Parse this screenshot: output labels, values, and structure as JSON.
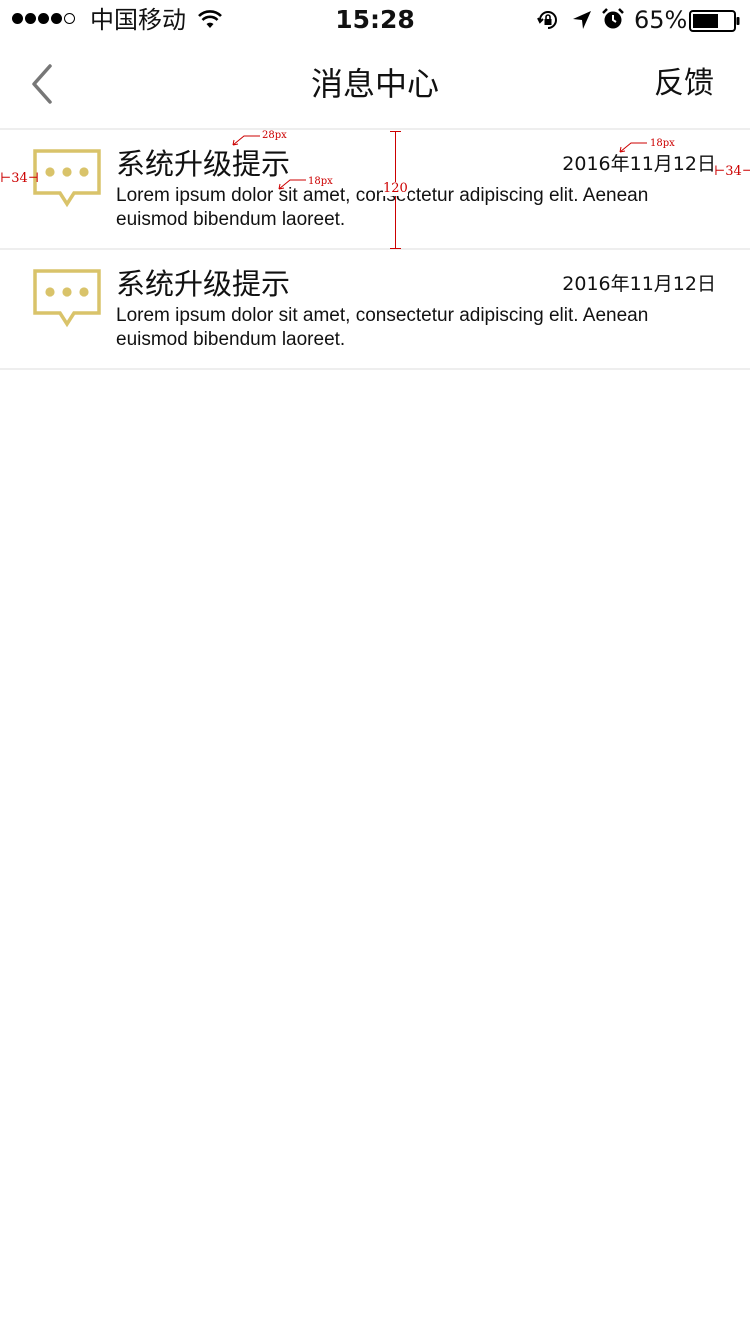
{
  "status_bar": {
    "carrier": "中国移动",
    "time": "15:28",
    "battery_percent": "65%",
    "battery_level": 0.65,
    "signal_bars_filled": 4,
    "signal_bars_total": 5,
    "icons": [
      "wifi-icon",
      "rotation-lock-icon",
      "location-icon",
      "alarm-icon",
      "battery-icon"
    ]
  },
  "nav": {
    "title": "消息中心",
    "right_button": "反馈",
    "back_icon": "chevron-left-icon"
  },
  "messages": [
    {
      "title": "系统升级提示",
      "date": "2016年11月12日",
      "body": "Lorem ipsum dolor sit amet, consectetur adipiscing elit. Aenean euismod bibendum laoreet.",
      "icon": "chat-bubble-icon"
    },
    {
      "title": "系统升级提示",
      "date": "2016年11月12日",
      "body": "Lorem ipsum dolor sit amet, consectetur adipiscing elit. Aenean euismod bibendum laoreet.",
      "icon": "chat-bubble-icon"
    }
  ],
  "annotations": {
    "title_size": "28px",
    "date_size": "18px",
    "body_size": "18px",
    "row_height": "120",
    "left_margin": "34",
    "right_margin": "34"
  },
  "colors": {
    "icon_accent": "#d9c36a",
    "divider": "#eeeeee",
    "annotation": "#cc0000"
  }
}
